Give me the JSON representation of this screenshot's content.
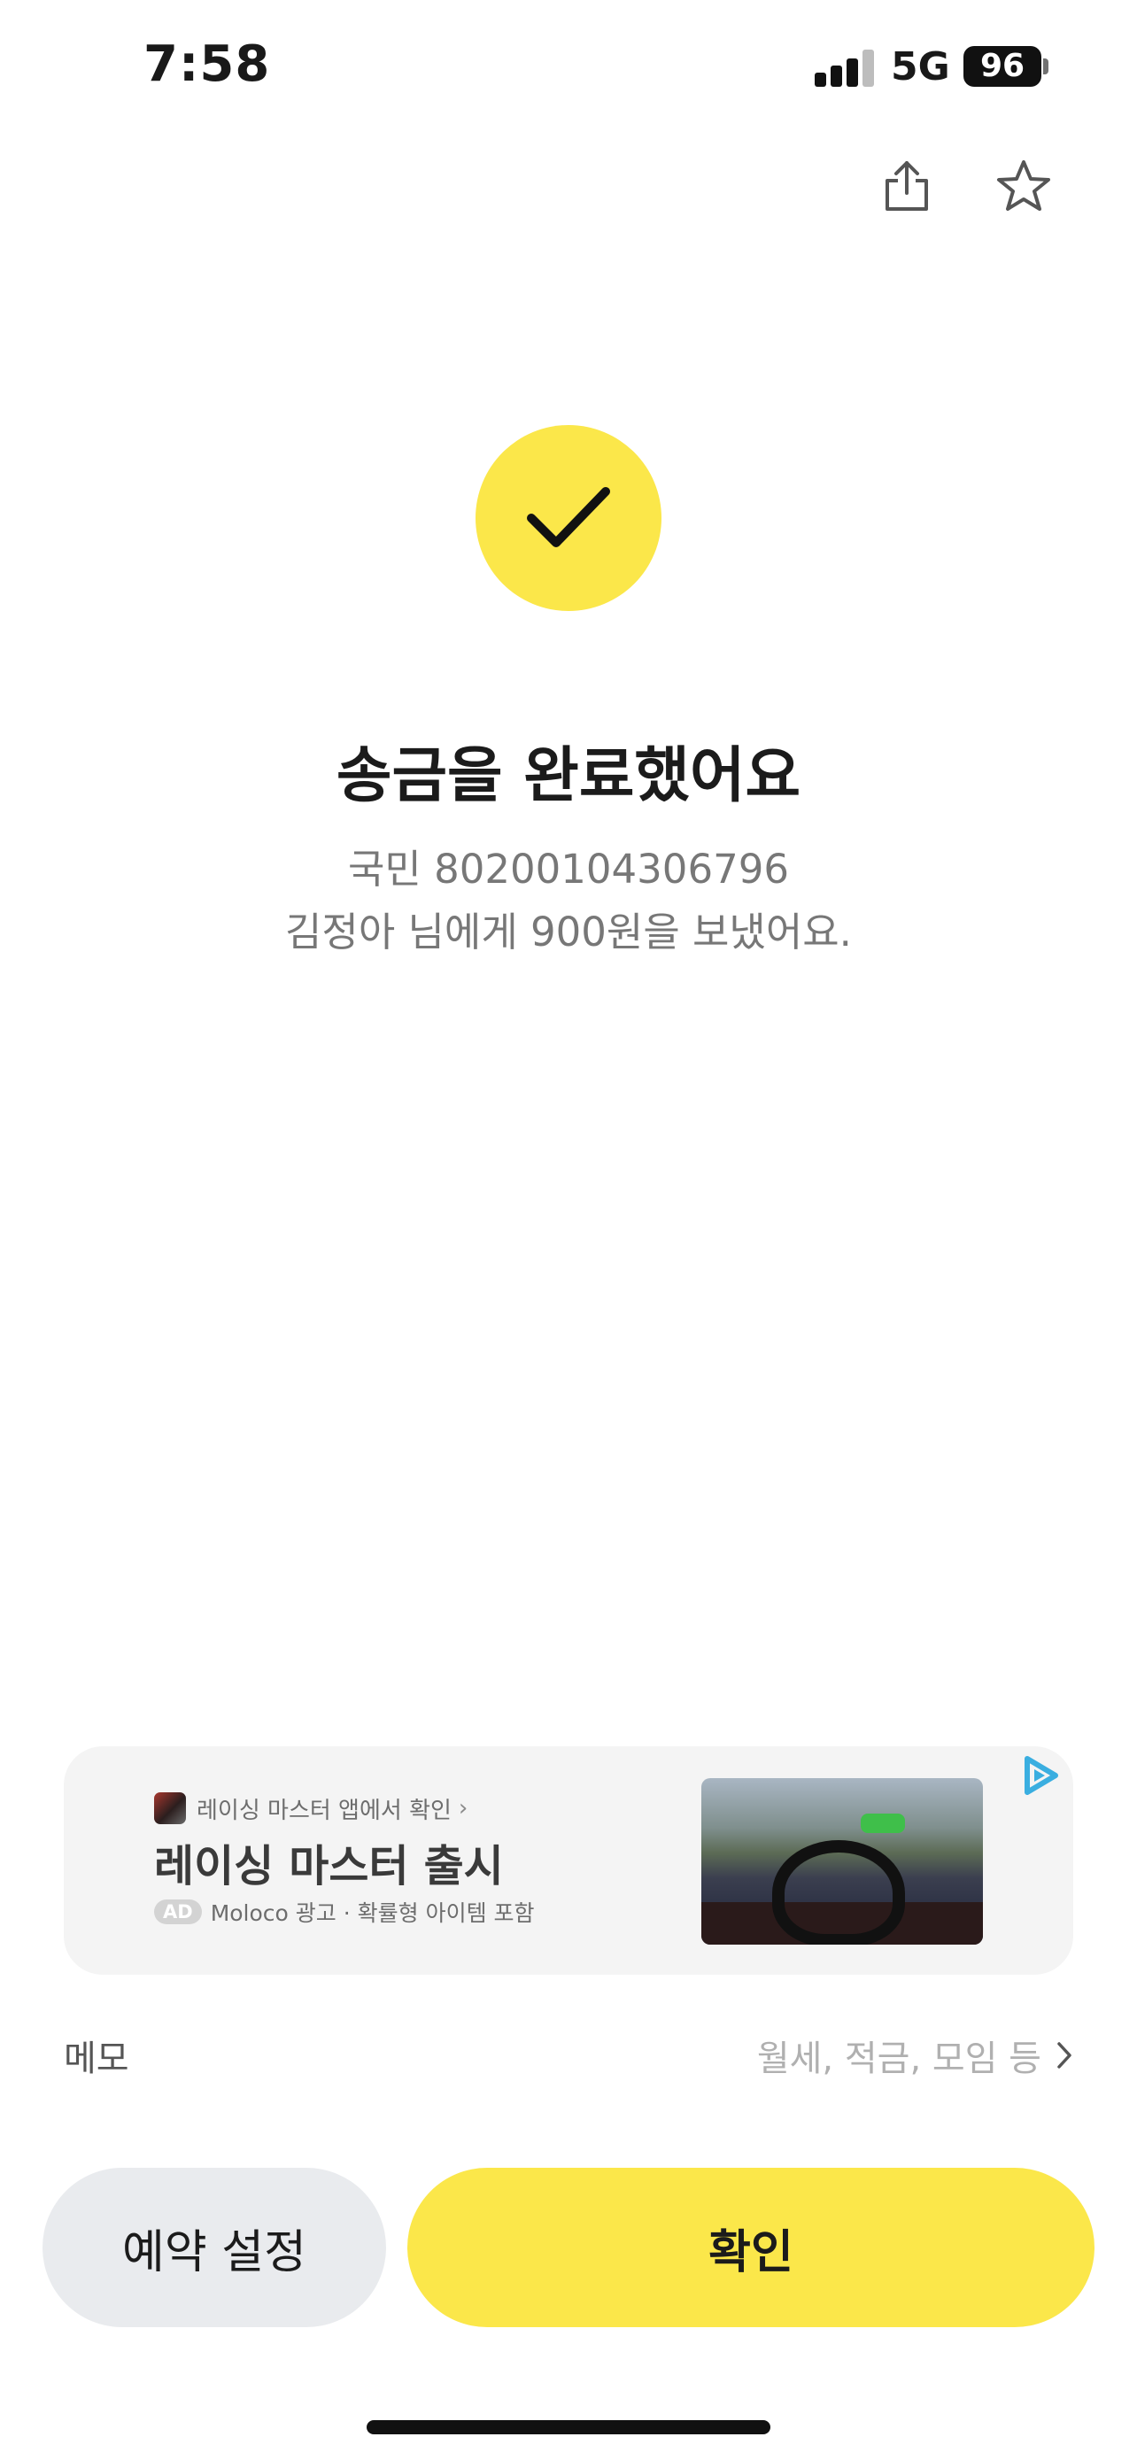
{
  "status_bar": {
    "time": "7:58",
    "network": "5G",
    "battery": "96"
  },
  "header": {
    "share_icon": "share-icon",
    "favorite_icon": "star-icon"
  },
  "result": {
    "icon": "check-icon",
    "accent_color": "#fbe74a",
    "title": "송금을 완료했어요",
    "account_line": "국민 80200104306796",
    "message_line": "김정아 님에게 900원을 보냈어요."
  },
  "ad": {
    "app_link": "레이싱 마스터 앱에서 확인",
    "app_chevron": "›",
    "title": "레이싱 마스터 출시",
    "badge": "AD",
    "meta": "Moloco 광고 · 확률형 아이템 포함",
    "choice_icon": "adchoices-icon"
  },
  "memo": {
    "label": "메모",
    "placeholder": "월세, 적금, 모임 등"
  },
  "actions": {
    "reserve_label": "예약 설정",
    "confirm_label": "확인"
  }
}
